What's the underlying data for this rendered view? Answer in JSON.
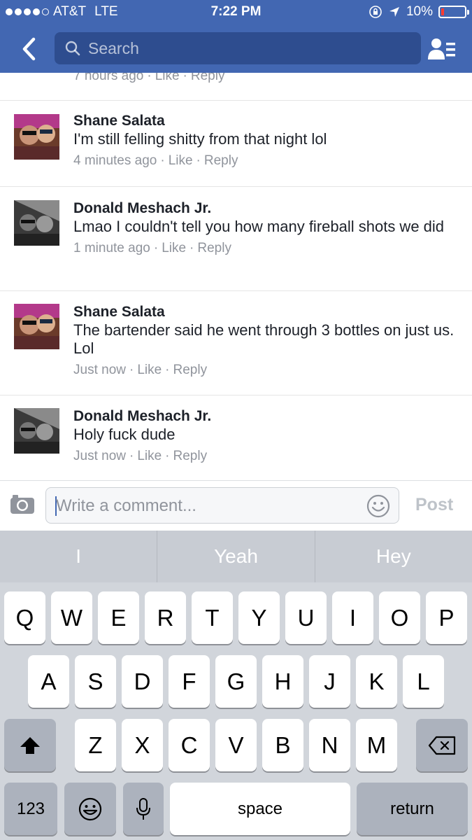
{
  "status_bar": {
    "carrier": "AT&T",
    "network": "LTE",
    "time": "7:22 PM",
    "battery": "10%",
    "battery_level": 0.1,
    "battery_color": "#ff3b30",
    "signal_bars_filled": 4,
    "signal_bars_total": 5
  },
  "nav": {
    "search_placeholder": "Search",
    "back_icon": "chevron-left-icon",
    "contacts_icon": "contacts-list-icon"
  },
  "colors": {
    "header": "#4267b2",
    "search_box": "#2e4d8f",
    "meta_text": "#90949c"
  },
  "comments": {
    "top_meta": {
      "time": "7 hours ago",
      "like": "Like",
      "reply": "Reply"
    },
    "items": [
      {
        "author": "Shane Salata",
        "text": "I'm still felling shitty from that night lol",
        "time": "4 minutes ago",
        "like": "Like",
        "reply": "Reply"
      },
      {
        "author": "Donald Meshach Jr.",
        "text": "Lmao I couldn't tell you how many fireball shots we did",
        "time": "1 minute ago",
        "like": "Like",
        "reply": "Reply"
      },
      {
        "author": "Shane Salata",
        "text": "The bartender said he went through 3 bottles on just us. Lol",
        "time": "Just now",
        "like": "Like",
        "reply": "Reply"
      },
      {
        "author": "Donald Meshach Jr.",
        "text": "Holy fuck dude",
        "time": "Just now",
        "like": "Like",
        "reply": "Reply"
      }
    ]
  },
  "composer": {
    "placeholder": "Write a comment...",
    "post_label": "Post"
  },
  "keyboard": {
    "predictions": [
      "I",
      "Yeah",
      "Hey"
    ],
    "row1": [
      "Q",
      "W",
      "E",
      "R",
      "T",
      "Y",
      "U",
      "I",
      "O",
      "P"
    ],
    "row2": [
      "A",
      "S",
      "D",
      "F",
      "G",
      "H",
      "J",
      "K",
      "L"
    ],
    "row3": [
      "Z",
      "X",
      "C",
      "V",
      "B",
      "N",
      "M"
    ],
    "numbers_label": "123",
    "space_label": "space",
    "return_label": "return"
  }
}
